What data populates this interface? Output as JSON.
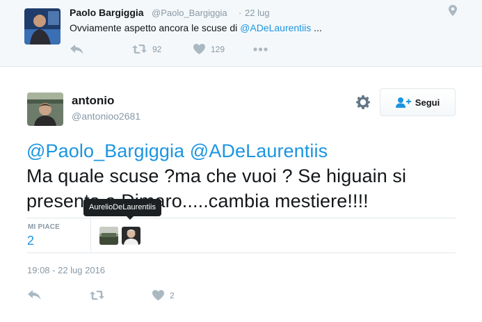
{
  "parent_tweet": {
    "author_name": "Paolo Bargiggia",
    "author_handle": "@Paolo_Bargiggia",
    "separator": "·",
    "time": "22 lug",
    "text_prefix": "Ovviamente aspetto ancora le scuse di ",
    "mention": "@ADeLaurentiis",
    "text_suffix": " ...",
    "retweet_count": "92",
    "like_count": "129"
  },
  "tweet": {
    "author_name": "antonio",
    "author_handle": "@antonioo2681",
    "follow_label": "Segui",
    "mention_1": "@Paolo_Bargiggia",
    "mention_2": "@ADeLaurentiis",
    "body": "Ma quale scuse ?ma che vuoi ? Se higuain si presenta a Dimaro.....cambia mestiere!!!!",
    "likes_label": "MI PIACE",
    "likes_count": "2",
    "timestamp": "19:08 - 22 lug 2016",
    "action_like_count": "2"
  },
  "tooltip": {
    "text": "AurelioDeLaurentiis"
  },
  "colors": {
    "accent": "#1b95e0",
    "muted": "#8899a6",
    "icon": "#aab8c2",
    "border": "#e1e8ed",
    "parent_bg": "#f5f8fa"
  },
  "icons": [
    "reply-icon",
    "retweet-icon",
    "heart-icon",
    "more-icon",
    "location-icon",
    "gear-icon",
    "follow-user-icon"
  ]
}
